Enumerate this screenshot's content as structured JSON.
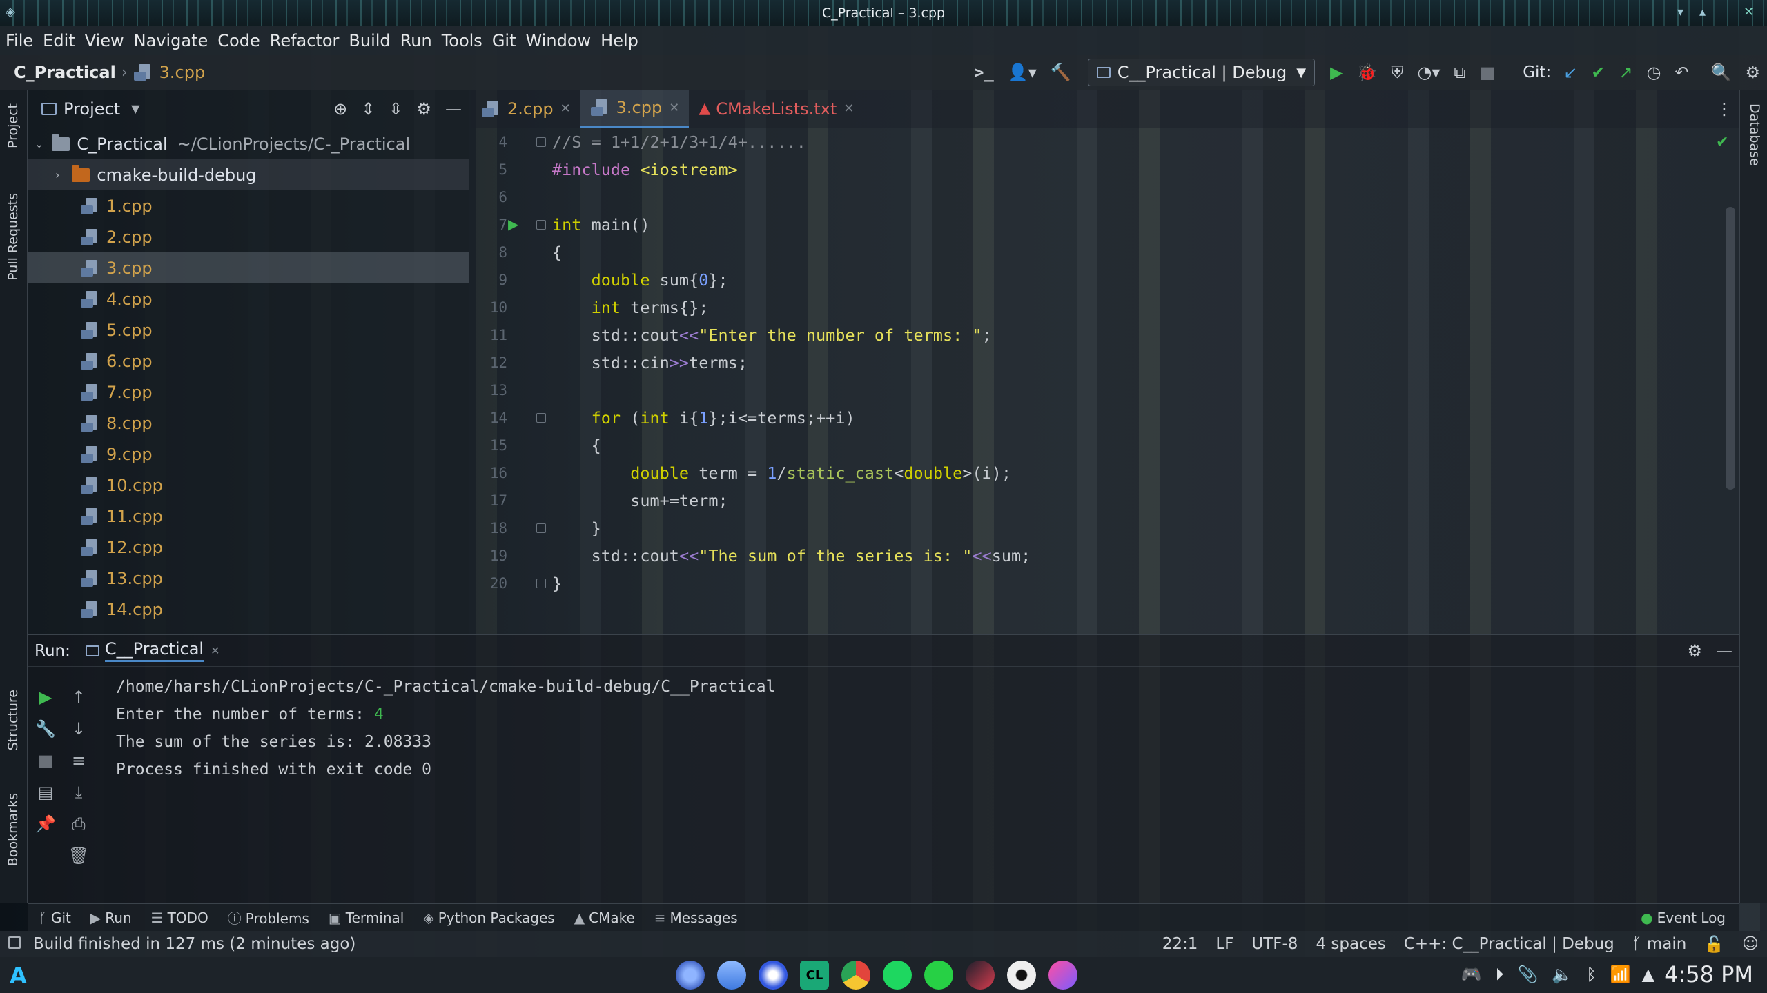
{
  "window": {
    "title": "C_Practical – 3.cpp"
  },
  "menu": [
    "File",
    "Edit",
    "View",
    "Navigate",
    "Code",
    "Refactor",
    "Build",
    "Run",
    "Tools",
    "Git",
    "Window",
    "Help"
  ],
  "breadcrumb": {
    "project": "C_Practical",
    "file": "3.cpp"
  },
  "toolbar": {
    "run_config": "C__Practical | Debug",
    "git_label": "Git:"
  },
  "project_panel": {
    "title": "Project",
    "root_name": "C_Practical",
    "root_path": "~/CLionProjects/C-_Practical",
    "folder": "cmake-build-debug",
    "files": [
      "1.cpp",
      "2.cpp",
      "3.cpp",
      "4.cpp",
      "5.cpp",
      "6.cpp",
      "7.cpp",
      "8.cpp",
      "9.cpp",
      "10.cpp",
      "11.cpp",
      "12.cpp",
      "13.cpp",
      "14.cpp"
    ],
    "selected": "3.cpp"
  },
  "editor": {
    "tabs": [
      {
        "label": "2.cpp"
      },
      {
        "label": "3.cpp"
      },
      {
        "label": "CMakeLists.txt"
      }
    ],
    "active_tab": "3.cpp",
    "line_numbers": [
      "4",
      "5",
      "6",
      "7",
      "8",
      "9",
      "10",
      "11",
      "12",
      "13",
      "14",
      "15",
      "16",
      "17",
      "18",
      "19",
      "20"
    ]
  },
  "run_panel": {
    "label": "Run:",
    "tab": "C__Practical",
    "output": [
      "/home/harsh/CLionProjects/C-_Practical/cmake-build-debug/C__Practical",
      "Enter the number of terms: ",
      "The sum of the series is: 2.08333",
      "Process finished with exit code 0"
    ],
    "input_value": "4"
  },
  "tool_tabs": [
    "Git",
    "Run",
    "TODO",
    "Problems",
    "Terminal",
    "Python Packages",
    "CMake",
    "Messages"
  ],
  "event_log": "Event Log",
  "left_stripe": [
    "Project",
    "Pull Requests",
    "Structure",
    "Bookmarks"
  ],
  "right_stripe": [
    "Database"
  ],
  "status": {
    "message": "Build finished in 127 ms (2 minutes ago)",
    "position": "22:1",
    "line_sep": "LF",
    "encoding": "UTF-8",
    "indent": "4 spaces",
    "context": "C++: C__Practical | Debug",
    "branch": "main"
  },
  "taskbar": {
    "time": "4:58 PM"
  },
  "colors": {
    "accent": "#4a88c7",
    "run_green": "#3fb950",
    "file_orange": "#d2a34c",
    "keyword": "#d0d000"
  }
}
